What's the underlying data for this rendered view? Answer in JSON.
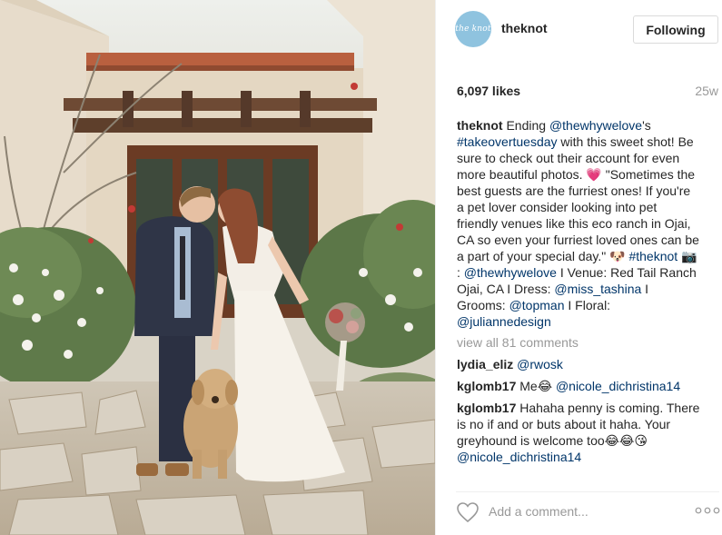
{
  "post": {
    "username": "theknot",
    "avatar_text": "the knot",
    "follow_label": "Following",
    "likes": "6,097 likes",
    "time": "25w"
  },
  "caption": {
    "username": "theknot",
    "t1": " Ending ",
    "m1": "@thewhywelove",
    "t2": "'s ",
    "m2": "#takeovertuesday",
    "t3": " with this sweet shot! Be sure to check out their account for even more beautiful photos. ",
    "e1": "💗",
    "t4": " \"Sometimes the best guests are the furriest ones! If you're a pet lover consider looking into pet friendly venues like this eco ranch in Ojai, CA so even your furriest loved ones can be a part of your special day.\" ",
    "e2": "🐶",
    "t5": " ",
    "m3": "#theknot",
    "t6": " ",
    "e3": "📷",
    "t7": ": ",
    "m4": "@thewhywelove",
    "t8": " I Venue: Red Tail Ranch Ojai, CA I Dress: ",
    "m5": "@miss_tashina",
    "t9": " I Grooms: ",
    "m6": "@topman",
    "t10": " I Floral: ",
    "m7": "@juliannedesign"
  },
  "view_all": "view all 81 comments",
  "comments": [
    {
      "username": "lydia_eliz",
      "pre": " ",
      "mention": "@rwosk",
      "post": ""
    },
    {
      "username": "kglomb17",
      "pre": " Me",
      "emoji": "😂",
      "mid": " ",
      "mention": "@nicole_dichristina14",
      "post": ""
    },
    {
      "username": "kglomb17",
      "pre": " Hahaha penny is coming. There is no if and or buts about it haha. Your greyhound is welcome too",
      "emoji": "😂😂😘",
      "mid": " ",
      "mention": "@nicole_dichristina14",
      "post": ""
    }
  ],
  "add_comment": {
    "placeholder": "Add a comment..."
  },
  "icons": {
    "like": "heart-icon",
    "options": "more-options-icon"
  },
  "colors": {
    "link": "#003569",
    "muted": "#999999",
    "avatar": "#8fc3df"
  }
}
